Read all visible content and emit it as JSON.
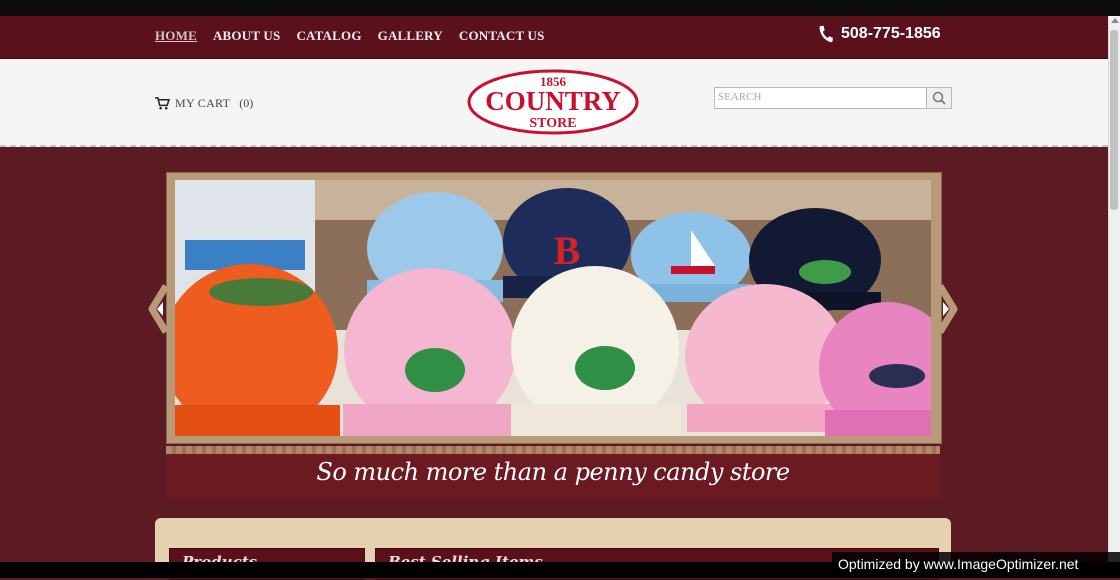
{
  "nav": {
    "links": [
      "HOME",
      "ABOUT US",
      "CATALOG",
      "GALLERY",
      "CONTACT US"
    ],
    "phone": "508-775-1856"
  },
  "header": {
    "cart_label": "MY CART",
    "cart_count": "(0)",
    "logo": {
      "year": "1856",
      "line1": "COUNTRY",
      "line2": "STORE"
    },
    "search_placeholder": "SEARCH"
  },
  "slider": {
    "caption": "So much more than a penny candy store"
  },
  "panels": {
    "products_title": "Products",
    "best_selling_title": "Best Selling Items"
  },
  "watermark": "Optimized by www.ImageOptimizer.net",
  "colors": {
    "brand_maroon": "#5a111b",
    "logo_red": "#c8102e",
    "panel_tan": "#e5d1b1"
  }
}
